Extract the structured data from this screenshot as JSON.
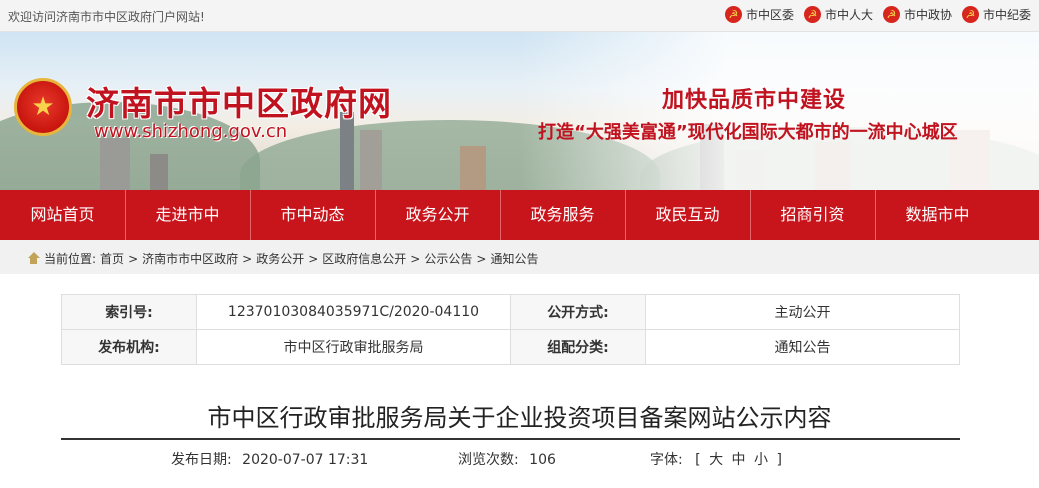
{
  "topbar": {
    "welcome": "欢迎访问济南市市中区政府门户网站!",
    "links": [
      "市中区委",
      "市中人大",
      "市中政协",
      "市中纪委"
    ]
  },
  "banner": {
    "site_title": "济南市市中区政府网",
    "site_url": "www.shizhong.gov.cn",
    "slogan_main": "加快品质市中建设",
    "slogan_sub": "打造“大强美富通”现代化国际大都市的一流中心城区"
  },
  "nav": {
    "items": [
      "网站首页",
      "走进市中",
      "市中动态",
      "政务公开",
      "政务服务",
      "政民互动",
      "招商引资",
      "数据市中"
    ]
  },
  "breadcrumb": {
    "label": "当前位置:",
    "items": [
      "首页",
      "济南市市中区政府",
      "政务公开",
      "区政府信息公开",
      "公示公告",
      "通知公告"
    ],
    "separator": ">"
  },
  "info": {
    "index_key": "索引号:",
    "index_value": "12370103084035971C/2020-04110",
    "method_key": "公开方式:",
    "method_value": "主动公开",
    "org_key": "发布机构:",
    "org_value": "市中区行政审批服务局",
    "category_key": "组配分类:",
    "category_value": "通知公告"
  },
  "article": {
    "title": "市中区行政审批服务局关于企业投资项目备案网站公示内容",
    "date_label": "发布日期:",
    "date_value": "2020-07-07 17:31",
    "views_label": "浏览次数:",
    "views_value": "106",
    "font_label": "字体:",
    "font_open": "[",
    "font_large": "大",
    "font_medium": "中",
    "font_small": "小",
    "font_close": "]"
  },
  "colors": {
    "brand_red": "#c8151c",
    "title_red": "#c1121f",
    "emblem_gold": "#e7b53b"
  }
}
